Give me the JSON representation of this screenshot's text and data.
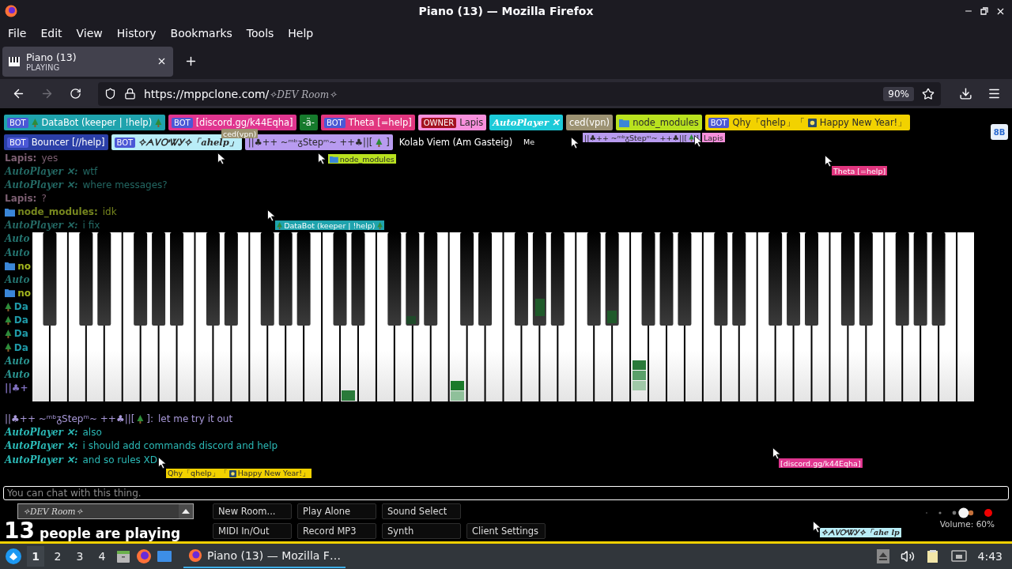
{
  "window": {
    "title": "Piano (13) — Mozilla Firefox"
  },
  "menu": [
    "File",
    "Edit",
    "View",
    "History",
    "Bookmarks",
    "Tools",
    "Help"
  ],
  "tabs": [
    {
      "title": "Piano (13)",
      "subtitle": "PLAYING",
      "selected": true
    }
  ],
  "address_bar": {
    "host": "https://mppclone.com/",
    "path": "✧DEV Room✧",
    "zoom": "90%"
  },
  "participant_rows": [
    [
      {
        "badge": {
          "text": "BOT",
          "kind": "bot"
        },
        "parts": [
          {
            "kind": "tree"
          },
          {
            "text": "DataBot (keeper | !help)"
          },
          {
            "kind": "tree"
          }
        ],
        "color": "#1fa3ad"
      },
      {
        "badge": {
          "text": "BOT",
          "kind": "bot"
        },
        "parts": [
          {
            "text": "[discord.gg/k44Eqha]"
          }
        ],
        "color": "#e0358f"
      },
      {
        "parts": [
          {
            "text": "-ä-"
          }
        ],
        "color": "#167a2c"
      },
      {
        "badge": {
          "text": "BOT",
          "kind": "bot"
        },
        "parts": [
          {
            "text": "Theta [=help]"
          }
        ],
        "color": "#e1367f"
      },
      {
        "badge": {
          "text": "OWNER",
          "kind": "owner"
        },
        "parts": [
          {
            "text": "Lapis"
          }
        ],
        "color": "#f790dc"
      },
      {
        "parts": [
          {
            "text": "AutoPlayer ✕",
            "kind": "script"
          }
        ],
        "color": "#1ccad8"
      },
      {
        "parts": [
          {
            "text": "ced(vpn)"
          }
        ],
        "color": "#9c9272"
      },
      {
        "parts": [
          {
            "kind": "folder"
          },
          {
            "text": "node_modules"
          }
        ],
        "color": "#b9e21f"
      },
      {
        "badge": {
          "text": "BOT",
          "kind": "bot"
        },
        "parts": [
          {
            "text": "Qhy「qhelp」「"
          },
          {
            "kind": "firework"
          },
          {
            "text": "Happy New Year!」"
          }
        ],
        "color": "#f2d200"
      }
    ],
    [
      {
        "badge": {
          "text": "BOT",
          "kind": "bot"
        },
        "parts": [
          {
            "text": "Bouncer [//help]"
          }
        ],
        "color": "#2b3fa8"
      },
      {
        "badge": {
          "text": "BOT",
          "kind": "bot"
        },
        "parts": [
          {
            "text": "✧ᗅᏙᎤᏔᎩ✧「ahelp」",
            "kind": "script"
          }
        ],
        "color": "#b9edf7"
      },
      {
        "parts": [
          {
            "text": "||♣++ ~ᵐᵇᵹStepᵐ~ ++♣||["
          },
          {
            "kind": "tree"
          },
          {
            "text": "]"
          }
        ],
        "color": "#b89bf0"
      },
      {
        "parts": [
          {
            "text": "Kolab Viem (Am Gasteig)"
          }
        ]
      }
    ]
  ],
  "side_button": "8B",
  "chat": [
    {
      "name": [
        {
          "text": "Lapis:",
          "kind": "bold"
        }
      ],
      "color": "#7d5f72",
      "text": "yes"
    },
    {
      "name": [
        {
          "text": "AutoPlayer ✕:",
          "kind": "script"
        }
      ],
      "color": "#236863",
      "text": "wtf"
    },
    {
      "name": [
        {
          "text": "AutoPlayer ✕:",
          "kind": "script"
        }
      ],
      "color": "#236863",
      "text": "where messages?"
    },
    {
      "name": [
        {
          "text": "Lapis:",
          "kind": "bold"
        }
      ],
      "color": "#7d5f72",
      "text": "?"
    },
    {
      "name": [
        {
          "kind": "folder"
        },
        {
          "text": "node_modules:",
          "kind": "bold"
        }
      ],
      "color": "#76861e",
      "text": "idk"
    },
    {
      "name": [
        {
          "text": "AutoPlayer ✕:",
          "kind": "script"
        }
      ],
      "color": "#236863",
      "text": "i fix"
    },
    {
      "name": [
        {
          "text": "Auto",
          "kind": "script"
        }
      ],
      "color": "#247470"
    },
    {
      "name": [
        {
          "text": "Auto",
          "kind": "script"
        }
      ],
      "color": "#247470"
    },
    {
      "name": [
        {
          "kind": "folder"
        },
        {
          "text": "no",
          "kind": "bold"
        }
      ],
      "color": "#a2b41e"
    },
    {
      "name": [
        {
          "text": "Auto",
          "kind": "script"
        }
      ],
      "color": "#247470"
    },
    {
      "name": [
        {
          "kind": "folder"
        },
        {
          "text": "no",
          "kind": "bold"
        }
      ],
      "color": "#a2b41e"
    },
    {
      "name": [
        {
          "kind": "tree"
        },
        {
          "text": "Da",
          "kind": "bold"
        }
      ],
      "color": "#1f9aa8"
    },
    {
      "name": [
        {
          "kind": "tree"
        },
        {
          "text": "Da",
          "kind": "bold"
        }
      ],
      "color": "#1f9aa8"
    },
    {
      "name": [
        {
          "kind": "tree"
        },
        {
          "text": "Da",
          "kind": "bold"
        }
      ],
      "color": "#1f9aa8"
    },
    {
      "name": [
        {
          "kind": "tree"
        },
        {
          "text": "Da",
          "kind": "bold"
        }
      ],
      "color": "#1f9aa8"
    },
    {
      "name": [
        {
          "text": "Auto",
          "kind": "script"
        }
      ],
      "color": "#2a9490"
    },
    {
      "name": [
        {
          "text": "Auto",
          "kind": "script"
        }
      ],
      "color": "#2a9490"
    },
    {
      "name": [
        {
          "text": "||♣+",
          "kind": "bold"
        }
      ],
      "color": "#8070c0"
    },
    {
      "name": [
        {
          "text": "||♣++ ~ᵐᵇᵹStepᵐ~ ++♣||["
        },
        {
          "kind": "tree"
        },
        {
          "text": "]:"
        }
      ],
      "color": "#a898d8",
      "text": "let me try it out"
    },
    {
      "name": [
        {
          "text": "AutoPlayer ✕:",
          "kind": "script"
        }
      ],
      "color": "#2bb9b6",
      "text": "also"
    },
    {
      "name": [
        {
          "text": "AutoPlayer ✕:",
          "kind": "script"
        }
      ],
      "color": "#2bb9b6",
      "text": "i should add commands discord and help"
    },
    {
      "name": [
        {
          "text": "AutoPlayer ✕:",
          "kind": "script"
        }
      ],
      "color": "#2bb9b6",
      "text": "and so rules XD"
    }
  ],
  "cursor_labels": [
    {
      "parts": [
        {
          "text": "ced(vpn)"
        }
      ],
      "color": "#9c9272"
    },
    {
      "parts": [
        {
          "text": "Me"
        }
      ]
    },
    {
      "parts": [
        {
          "text": "||♣++ ~ᵐᵇᵹStepᵐ~ ++♣||["
        },
        {
          "kind": "tree"
        },
        {
          "text": "]"
        }
      ],
      "color": "#b89bf0"
    },
    {
      "parts": [
        {
          "text": "Lapis"
        }
      ],
      "color": "#f790dc"
    },
    {
      "parts": [
        {
          "kind": "folder"
        },
        {
          "text": "node_modules"
        }
      ],
      "color": "#b9e21f"
    },
    {
      "parts": [
        {
          "text": "Theta [=help]"
        }
      ],
      "color": "#e1367f"
    },
    {
      "parts": [
        {
          "kind": "tree"
        },
        {
          "text": "DataBot (keeper | !help)"
        },
        {
          "kind": "tree"
        }
      ],
      "color": "#1fa3ad"
    },
    {
      "parts": [
        {
          "text": "Qhy「qhelp」「"
        },
        {
          "kind": "firework"
        },
        {
          "text": "Happy New Year!」"
        }
      ],
      "color": "#f2d200"
    },
    {
      "parts": [
        {
          "text": "[discord.gg/k44Eqha]"
        }
      ],
      "color": "#e0358f"
    },
    {
      "parts": [
        {
          "text": "✧ᗅᏙᎤᏔᎩ✧「ahe lp",
          "kind": "script"
        }
      ],
      "color": "#b9edf7"
    }
  ],
  "chat_input": {
    "placeholder": "You can chat with this thing."
  },
  "room_select": {
    "value": "✧DEV Room✧"
  },
  "player_count": {
    "count": "13",
    "label": "people are playing"
  },
  "buttons": [
    [
      "New Room...",
      "Play Alone",
      "Sound Select"
    ],
    [
      "MIDI In/Out",
      "Record MP3",
      "Synth",
      "Client Settings"
    ]
  ],
  "volume": {
    "level": 0.6,
    "reading": "Volume: 60%"
  },
  "taskbar": {
    "workspaces": [
      {
        "label": "1",
        "selected": true
      },
      {
        "label": "2",
        "selected": false
      },
      {
        "label": "3",
        "selected": false
      },
      {
        "label": "4",
        "selected": false
      }
    ],
    "task": "Piano (13) — Mozilla F…",
    "clock": "4:43"
  }
}
